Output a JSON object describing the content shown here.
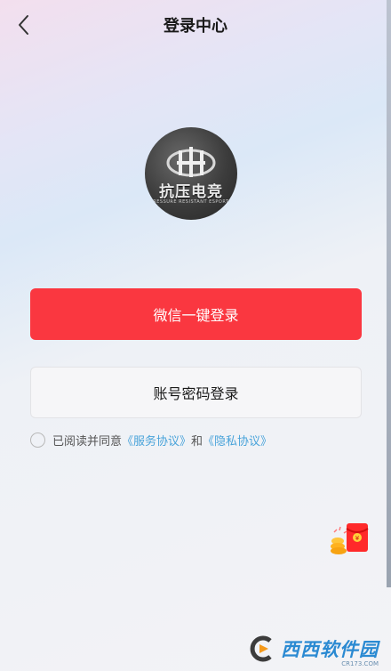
{
  "header": {
    "title": "登录中心",
    "back_icon": "chevron-left-icon"
  },
  "logo": {
    "text": "抗压电竞",
    "subtext": "PRESSURE RESISTANT ESPORTS"
  },
  "buttons": {
    "wechat_login": "微信一键登录",
    "password_login": "账号密码登录"
  },
  "agreement": {
    "prefix": "已阅读并同意",
    "service_link": "《服务协议》",
    "conjunction": "和",
    "privacy_link": "《隐私协议》",
    "checked": false
  },
  "watermark": {
    "brand": "西西软件园",
    "url": "CR173.COM"
  },
  "colors": {
    "primary": "#fa3740",
    "link": "#4aa4da",
    "title": "#1a1a1a"
  }
}
